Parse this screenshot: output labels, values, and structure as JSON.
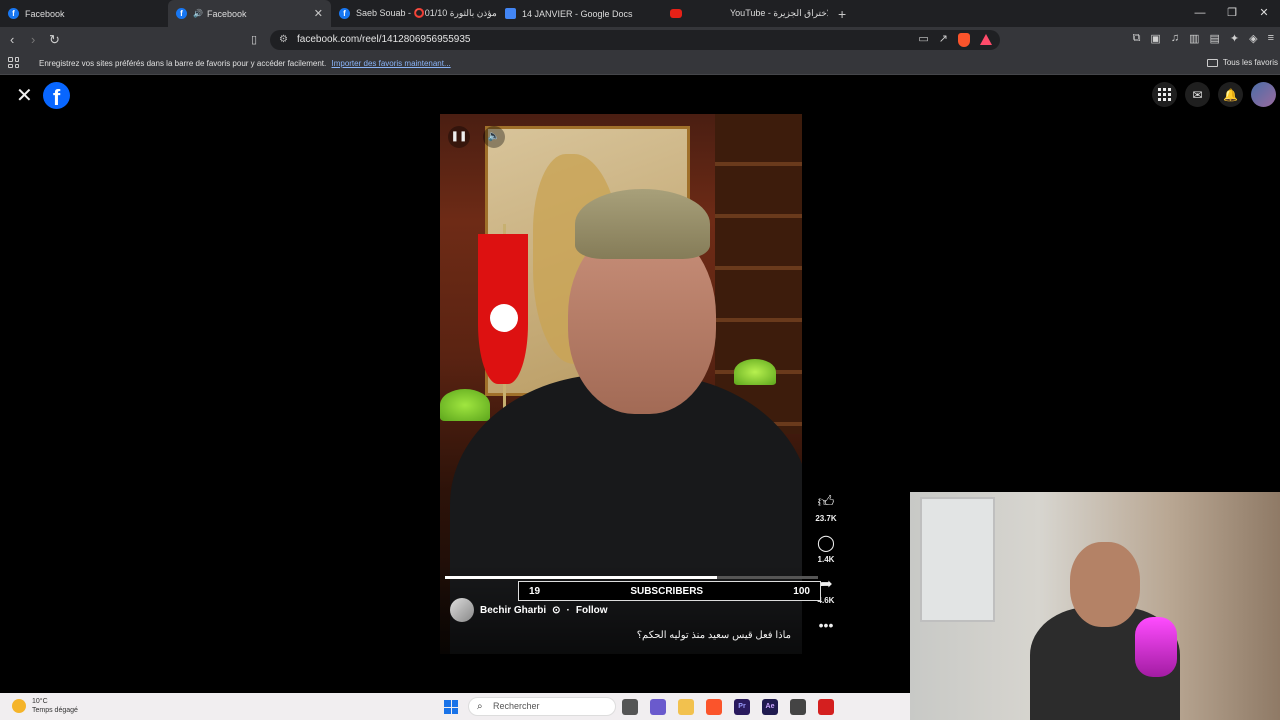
{
  "browser": {
    "tabs": [
      {
        "label": "Facebook",
        "active": false
      },
      {
        "label": "Facebook",
        "active": true
      },
      {
        "label": "Saeb Souab - ⭕01/10 مؤذن بالثورة",
        "active": false
      },
      {
        "label": "14 JANVIER - Google Docs",
        "active": false
      },
      {
        "label": "YouTube - الاختراق الجزيرة",
        "active": false
      }
    ],
    "url": "facebook.com/reel/1412806956955935",
    "bookmarks_message": "Enregistrez vos sites préférés dans la barre de favoris pour y accéder facilement.",
    "bookmarks_import_link": "Importer des favoris maintenant...",
    "all_bookmarks": "Tous les favoris"
  },
  "reel": {
    "author": "Bechir Gharbi",
    "follow": "Follow",
    "caption": "ماذا فعل قيس سعيد منذ توليه الحكم؟",
    "likes": "23.7K",
    "comments": "1.4K",
    "shares": "4.6K",
    "progress": 0.73
  },
  "overlay": {
    "left_value": "19",
    "center_label": "SUBSCRIBERS",
    "right_value": "100"
  },
  "taskbar": {
    "temperature": "10°C",
    "weather": "Temps dégagé",
    "search_placeholder": "Rechercher"
  },
  "colors": {
    "facebook_blue": "#0866ff",
    "brave_orange": "#fb542b"
  }
}
